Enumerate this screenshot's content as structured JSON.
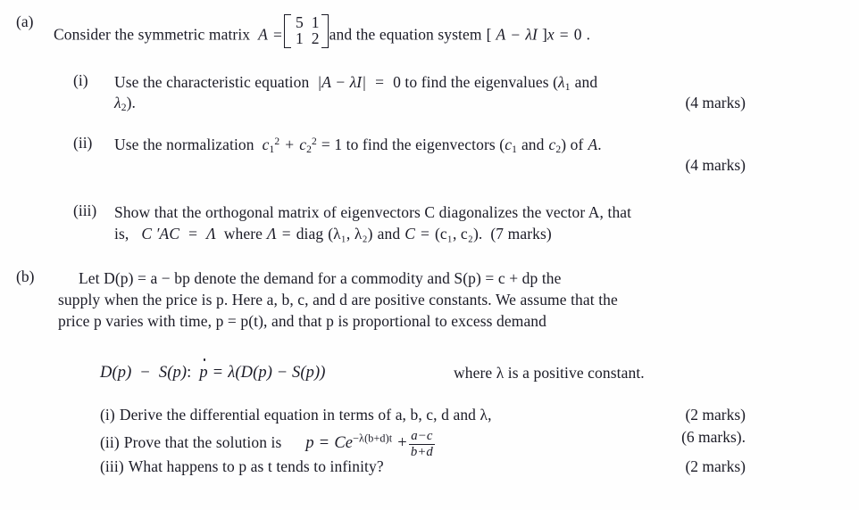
{
  "document": {
    "background_color": "#fefefe",
    "text_color": "#1b1b26",
    "part_a": {
      "label": "(a)",
      "intro_prefix": "Consider the symmetric matrix",
      "matrix_var": "A",
      "equals": "=",
      "matrix": [
        [
          "5",
          "1"
        ],
        [
          "1",
          "2"
        ]
      ],
      "intro_suffix": "and the equation system",
      "system_open": "[",
      "system_expr_A": "A",
      "system_minus": "−",
      "system_lambda": "λ",
      "system_I": "I",
      "system_close": "]",
      "system_x": "x",
      "system_eq": "=",
      "system_zero": "0",
      "system_period": ".",
      "items": [
        {
          "numeral": "(i)",
          "line1_a": "Use the characteristic equation",
          "line1_det": "|A − λI|",
          "line1_eq": "=",
          "line1_b": "0 to find the eigenvalues (",
          "line1_lambda1": "λ",
          "line1_sub1": "1",
          "line1_c": "and",
          "line2_lambda2": "λ",
          "line2_sub2": "2",
          "line2_tail": ").",
          "marks": "(4 marks)"
        },
        {
          "numeral": "(ii)",
          "line1_a": "Use the normalization",
          "line1_c1": "c",
          "line1_c1_sub": "1",
          "line1_c1_sup": "2",
          "line1_plus": "+",
          "line1_c2": "c",
          "line1_c2_sub": "2",
          "line1_c2_sup": "2",
          "line1_eq": "= 1 to find the eigenvectors (",
          "line1_cc1": "c",
          "line1_cc1_sub": "1",
          "line1_and": "and",
          "line1_cc2": "c",
          "line1_cc2_sub": "2",
          "line1_tail": ") of",
          "line1_A": "A",
          "line1_period": ".",
          "marks": "(4 marks)"
        },
        {
          "numeral": "(iii)",
          "line1": "Show that the orthogonal matrix of eigenvectors C diagonalizes the vector A, that",
          "line2_is": "is,",
          "line2_CAC": "C ′AC",
          "line2_eq1": "=",
          "line2_Lambda1": "Λ",
          "line2_where": "where",
          "line2_Lambda2": "Λ",
          "line2_eq2": "=",
          "line2_diag": "diag",
          "line2_diag_args": "(λ₁, λ₂)",
          "line2_and": "and",
          "line2_C": "C",
          "line2_eq3": "=",
          "line2_C_args": "(c₁, c₂).",
          "marks": "(7 marks)"
        }
      ]
    },
    "part_b": {
      "label": "(b)",
      "line1": "Let D(p) = a − bp denote the demand for a commodity and S(p) = c + dp the",
      "line2": "supply when the price is p. Here a, b, c, and d are positive constants. We assume that the",
      "line3": "price p varies with time, p = p(t), and that p is proportional to excess demand",
      "equation": {
        "lhs_D": "D",
        "lhs_p1": "(p)",
        "minus": "−",
        "lhs_S": "S",
        "lhs_p2": "(p)",
        "colon": ":",
        "pdot": "p",
        "eq": "=",
        "lambda": "λ",
        "rhs": "(D(p) − S(p))",
        "where_text": "where λ is a positive constant."
      },
      "items": [
        {
          "numeral": "(i)",
          "text": "Derive the differential equation in terms of a, b, c, d and λ,",
          "marks": "(2 marks)"
        },
        {
          "numeral": "(ii)",
          "text_prefix": "Prove that the solution is",
          "formula_p": "p",
          "formula_eq": "=",
          "formula_C": "C",
          "formula_e": "e",
          "formula_exp": "−λ(b+d)t",
          "formula_plus": "+",
          "formula_num": "a−c",
          "formula_den": "b+d",
          "marks": "(6 marks)."
        },
        {
          "numeral": "(iii)",
          "text": "What happens to p as t tends to infinity?",
          "marks": "(2 marks)"
        }
      ]
    }
  }
}
